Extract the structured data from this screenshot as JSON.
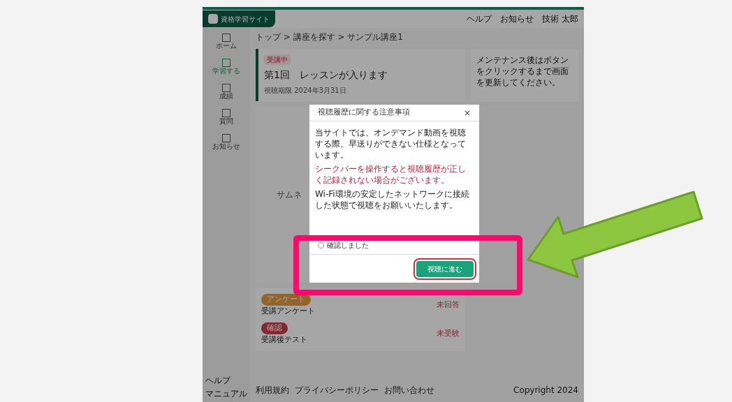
{
  "header": {
    "logo_text": "資格学習サイト",
    "links": [
      "ヘルプ",
      "お知らせ",
      "技術 太郎"
    ]
  },
  "sidebar": {
    "items": [
      {
        "label": "ホーム",
        "selected": false
      },
      {
        "label": "学習する",
        "selected": true
      },
      {
        "label": "成績",
        "selected": false
      },
      {
        "label": "質問",
        "selected": false
      },
      {
        "label": "お知らせ",
        "selected": false
      }
    ],
    "footer_links": [
      "ヘルプ",
      "マニュアル"
    ]
  },
  "breadcrumb": "トップ > 講座を探す > サンプル講座1",
  "lesson": {
    "badge": "受講中",
    "title": "第1回　レッスンが入ります",
    "deadline": "視聴期限 2024年3月31日"
  },
  "notice": "メンテナンス後はボタンをクリックするまで画面を更新してください。",
  "thumbnail": "サムネ",
  "tasks": [
    {
      "badge": "アンケート",
      "title": "受講アンケート",
      "kind": "survey",
      "status": "未回答"
    },
    {
      "badge": "確認",
      "title": "受講後テスト",
      "kind": "test",
      "status": "未受験"
    }
  ],
  "footer": {
    "links": [
      "利用規約",
      "プライバシーポリシー",
      "お問い合わせ"
    ],
    "copyright": "Copyright 2024"
  },
  "modal": {
    "title": "視聴履歴に関する注意事項",
    "close": "×",
    "paragraphs": [
      {
        "text": "当サイトでは、オンデマンド動画を視聴する際、早送りができない仕様となっています。",
        "warning": false
      },
      {
        "text": "シークバーを操作すると視聴履歴が正しく記録されない場合がございます。",
        "warning": true
      },
      {
        "text": "Wi-Fi環境の安定したネットワークに接続した状態で視聴をお願いいたします。",
        "warning": false
      }
    ],
    "checkbox": {
      "label": "確認しました",
      "checked": false
    },
    "button": "視聴に進む"
  }
}
